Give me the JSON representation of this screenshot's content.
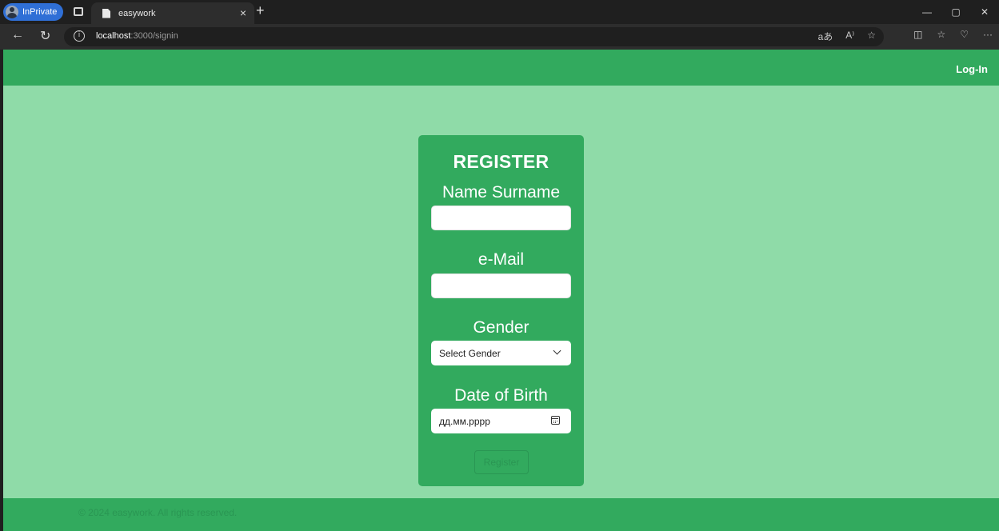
{
  "browser": {
    "inprivate_label": "InPrivate",
    "tab_title": "easywork",
    "tab_close": "×",
    "new_tab": "+",
    "url_host": "localhost",
    "url_path": ":3000/signin",
    "window_controls": {
      "minimize": "—",
      "restore": "▢",
      "close": "✕"
    },
    "nav": {
      "back": "←",
      "refresh": "↻"
    },
    "address_icons": {
      "read_aloud_lang": "aあ",
      "read_aloud": "A⁾",
      "favorite": "☆"
    },
    "toolbar_icons": {
      "split": "◫",
      "favorites": "☆",
      "copilot": "♡",
      "more": "···"
    }
  },
  "header": {
    "login_label": "Log-In"
  },
  "form": {
    "title": "REGISTER",
    "name_label": "Name Surname",
    "email_label": "e-Mail",
    "gender_label": "Gender",
    "gender_value": "Select Gender",
    "dob_label": "Date of Birth",
    "dob_placeholder": "дд.мм.рррр",
    "submit_label": "Register"
  },
  "footer": {
    "copyright": "© 2024 easywork. All rights reserved."
  },
  "colors": {
    "primary": "#32aa5e",
    "background": "#8fdba8",
    "muted_text": "#2a9653"
  }
}
